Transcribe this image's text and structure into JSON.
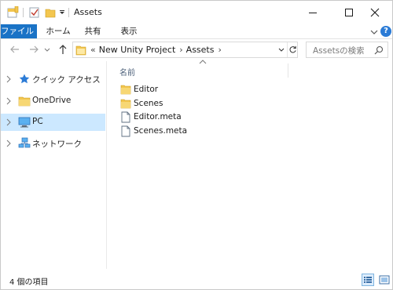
{
  "window": {
    "title": "Assets"
  },
  "ribbon": {
    "tabs": [
      {
        "label": "ファイル",
        "active": true
      },
      {
        "label": "ホーム"
      },
      {
        "label": "共有"
      },
      {
        "label": "表示"
      }
    ],
    "help_label": "?"
  },
  "address": {
    "overflow": "«",
    "crumbs": [
      "New Unity Project",
      "Assets"
    ]
  },
  "search": {
    "placeholder": "Assetsの検索"
  },
  "nav_pane": {
    "items": [
      {
        "label": "クイック アクセス",
        "icon": "star-icon",
        "selected": false
      },
      {
        "label": "OneDrive",
        "icon": "folder-icon",
        "selected": false
      },
      {
        "label": "PC",
        "icon": "computer-icon",
        "selected": true
      },
      {
        "label": "ネットワーク",
        "icon": "network-icon",
        "selected": false
      }
    ]
  },
  "file_list": {
    "column_name": "名前",
    "items": [
      {
        "name": "Editor",
        "type": "folder"
      },
      {
        "name": "Scenes",
        "type": "folder"
      },
      {
        "name": "Editor.meta",
        "type": "file"
      },
      {
        "name": "Scenes.meta",
        "type": "file"
      }
    ]
  },
  "status_bar": {
    "text": "4 個の項目"
  },
  "colors": {
    "accent": "#1a73c6",
    "selection": "#cce8ff",
    "folder": "#f3c64f"
  }
}
